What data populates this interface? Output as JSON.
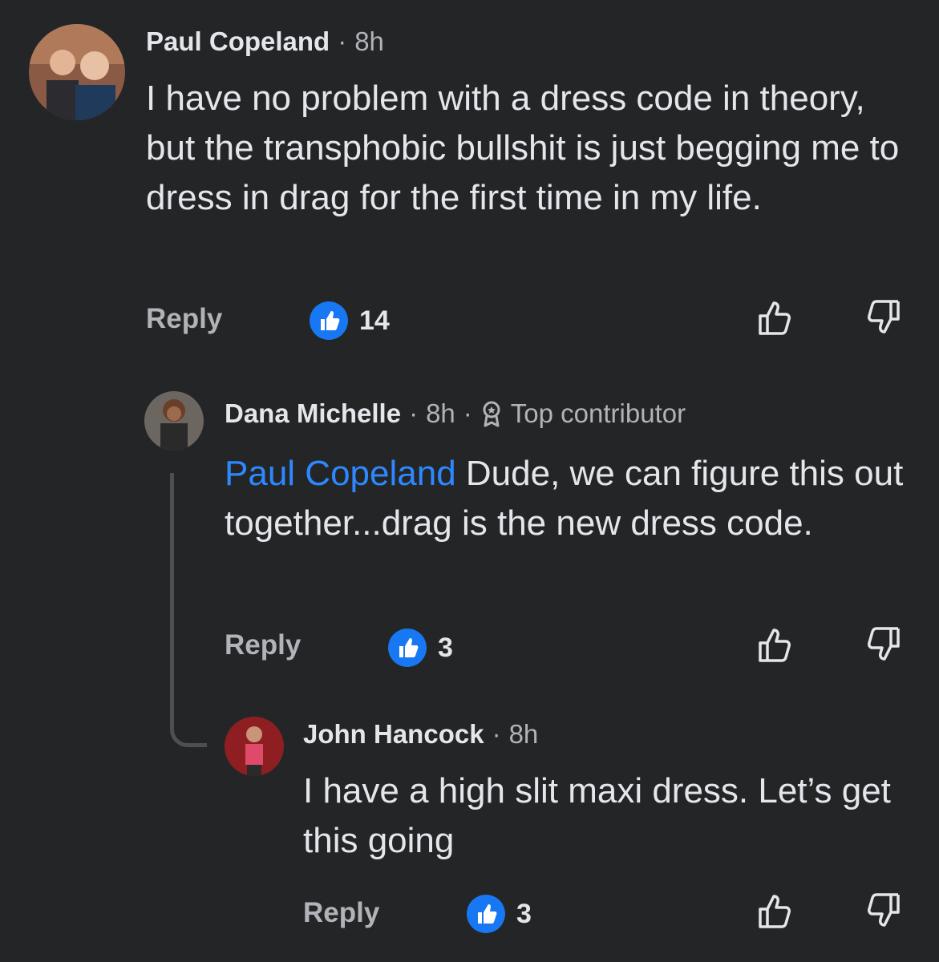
{
  "comments": [
    {
      "author": "Paul Copeland",
      "time": "8h",
      "text": "I have no problem with a dress code in theory, but the transphobic bullshit is just begging me to dress in drag for the first time in my life.",
      "reply_label": "Reply",
      "like_count": "14",
      "avatar_icon": "avatar-photo",
      "like_icon": "thumbs-up-filled-icon",
      "upvote_icon": "thumbs-up-outline-icon",
      "downvote_icon": "thumbs-down-outline-icon"
    },
    {
      "author": "Dana Michelle",
      "time": "8h",
      "badge": "Top contributor",
      "badge_icon": "award-ribbon-icon",
      "mention": "Paul Copeland",
      "text": " Dude, we can figure this out together...drag  is the new dress code.",
      "reply_label": "Reply",
      "like_count": "3"
    },
    {
      "author": "John Hancock",
      "time": "8h",
      "text": "I have a high slit maxi dress. Let’s get this going",
      "reply_label": "Reply",
      "like_count": "3"
    }
  ],
  "separator": "·",
  "colors": {
    "background": "#242526",
    "primary_text": "#e4e6eb",
    "secondary_text": "#b0b3b8",
    "mention": "#2d88ff",
    "like_badge": "#1877f2"
  }
}
